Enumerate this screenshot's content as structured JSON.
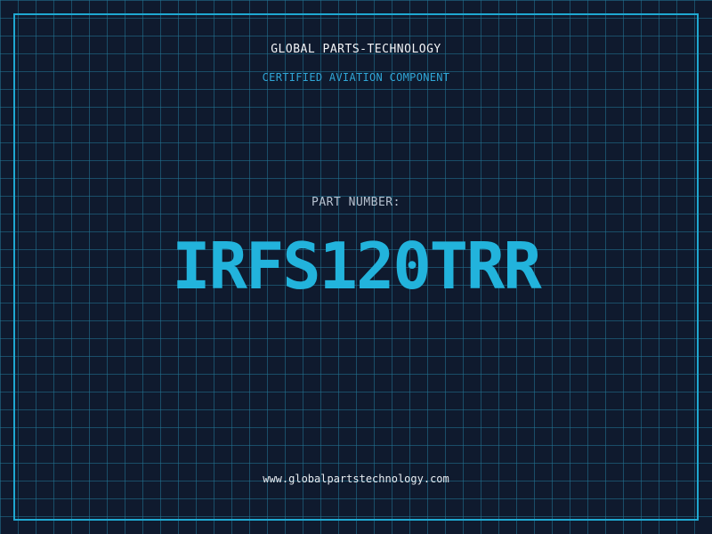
{
  "header": {
    "company": "GLOBAL PARTS-TECHNOLOGY",
    "subtitle": "CERTIFIED AVIATION COMPONENT"
  },
  "part": {
    "label": "PART NUMBER:",
    "number": "IRFS120TRR"
  },
  "footer": {
    "url": "www.globalpartstechnology.com"
  },
  "colors": {
    "background": "#0f1a2e",
    "grid": "#227696",
    "accent": "#22b3dc",
    "text": "#f2f4f7"
  }
}
